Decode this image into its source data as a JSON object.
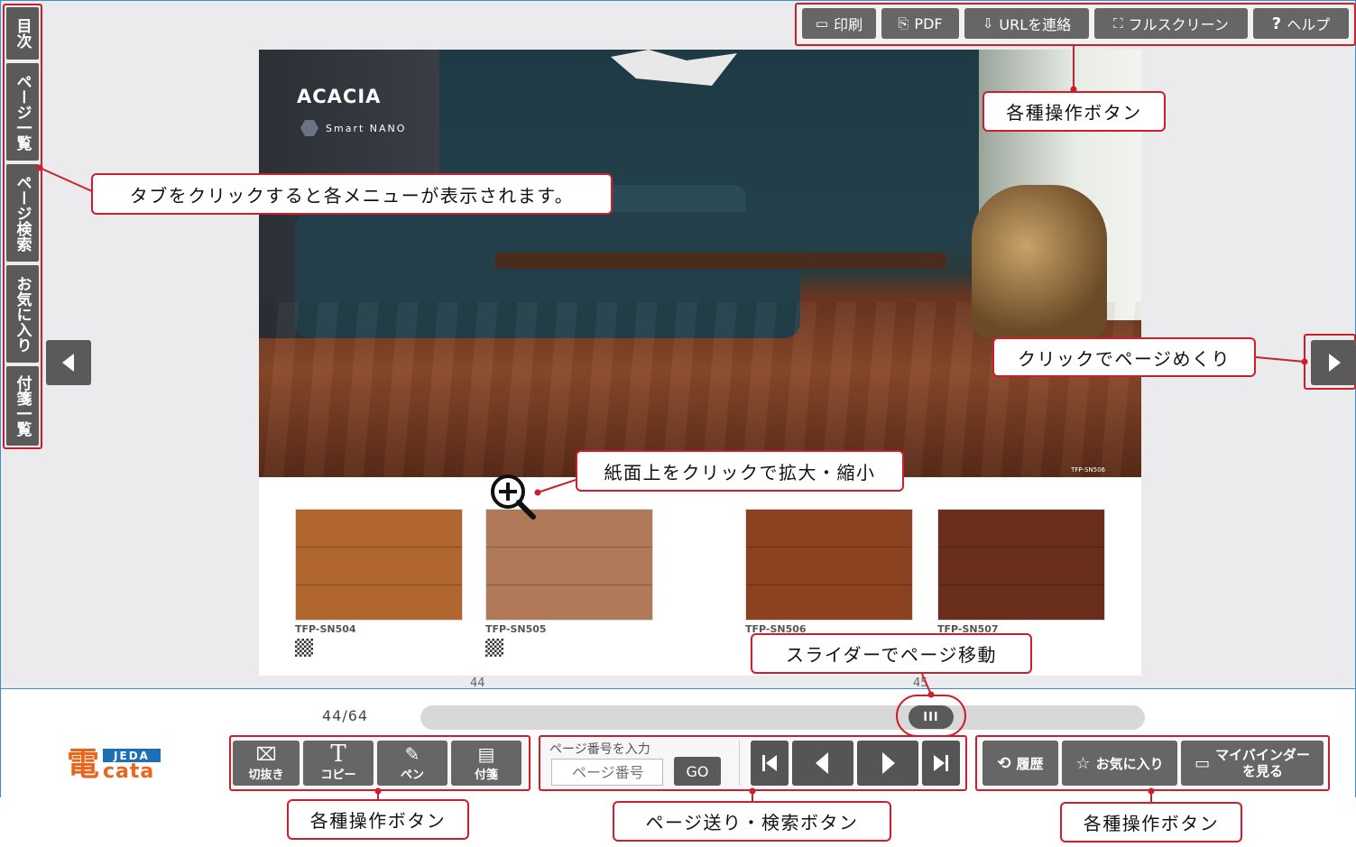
{
  "sidetabs": {
    "items": [
      {
        "label": "目次"
      },
      {
        "label": "ページ一覧"
      },
      {
        "label": "ページ検索"
      },
      {
        "label": "お気に入り"
      },
      {
        "label": "付箋一覧"
      }
    ]
  },
  "toolbar": {
    "items": [
      {
        "label": "印刷",
        "icon": "print-icon"
      },
      {
        "label": "PDF",
        "icon": "pdf-icon"
      },
      {
        "label": "URLを連絡",
        "icon": "share-url-icon"
      },
      {
        "label": "フルスクリーン",
        "icon": "fullscreen-icon"
      },
      {
        "label": "ヘルプ",
        "icon": "help-icon",
        "glyph": "?"
      }
    ]
  },
  "page": {
    "brand": "ACACIA",
    "sub_brand": "Smart NANO",
    "photo_code": "TFP-SN506",
    "products": [
      {
        "code": "TFP-SN504",
        "color": "#b0662e"
      },
      {
        "code": "TFP-SN505",
        "color": "#b07a58"
      },
      {
        "code": "TFP-SN506",
        "color": "#8c4220"
      },
      {
        "code": "TFP-SN507",
        "color": "#6a2e1c"
      }
    ]
  },
  "slider": {
    "left_page_label": "44",
    "right_page_label": "45",
    "counter": "44/64",
    "thumb_glyph": "III",
    "position": 0.72
  },
  "tools": {
    "items": [
      {
        "label": "切抜き",
        "icon": "crop-icon",
        "glyph": "⌧"
      },
      {
        "label": "コピー",
        "icon": "text-copy-icon",
        "glyph": "T"
      },
      {
        "label": "ペン",
        "icon": "pen-icon",
        "glyph": "✎"
      },
      {
        "label": "付箋",
        "icon": "sticky-note-icon",
        "glyph": "▤"
      }
    ]
  },
  "pagesearch": {
    "label": "ページ番号を入力",
    "placeholder": "ページ番号",
    "go_label": "GO"
  },
  "rtools": {
    "items": [
      {
        "label": "履歴",
        "icon": "history-icon",
        "glyph": "⟲"
      },
      {
        "label": "お気に入り",
        "icon": "star-icon",
        "glyph": "☆"
      },
      {
        "label": "マイバインダーを見る",
        "line1": "マイバインダー",
        "line2": "を見る",
        "icon": "folder-icon",
        "glyph": "▭"
      }
    ]
  },
  "logo": {
    "main": "電",
    "jeda": "JEDA",
    "cata": "cata"
  },
  "callouts": {
    "tabs": "タブをクリックすると各メニューが表示されます。",
    "top_tools": "各種操作ボタン",
    "page_turn": "クリックでページめくり",
    "zoom": "紙面上をクリックで拡大・縮小",
    "slider": "スライダーでページ移動",
    "bottom_tools_left": "各種操作ボタン",
    "nav": "ページ送り・検索ボタン",
    "bottom_tools_right": "各種操作ボタン"
  },
  "colors": {
    "accent": "#cc1f2b",
    "button": "#5a5a5a",
    "logo_orange": "#e8651e",
    "logo_blue": "#1d6fb8"
  }
}
